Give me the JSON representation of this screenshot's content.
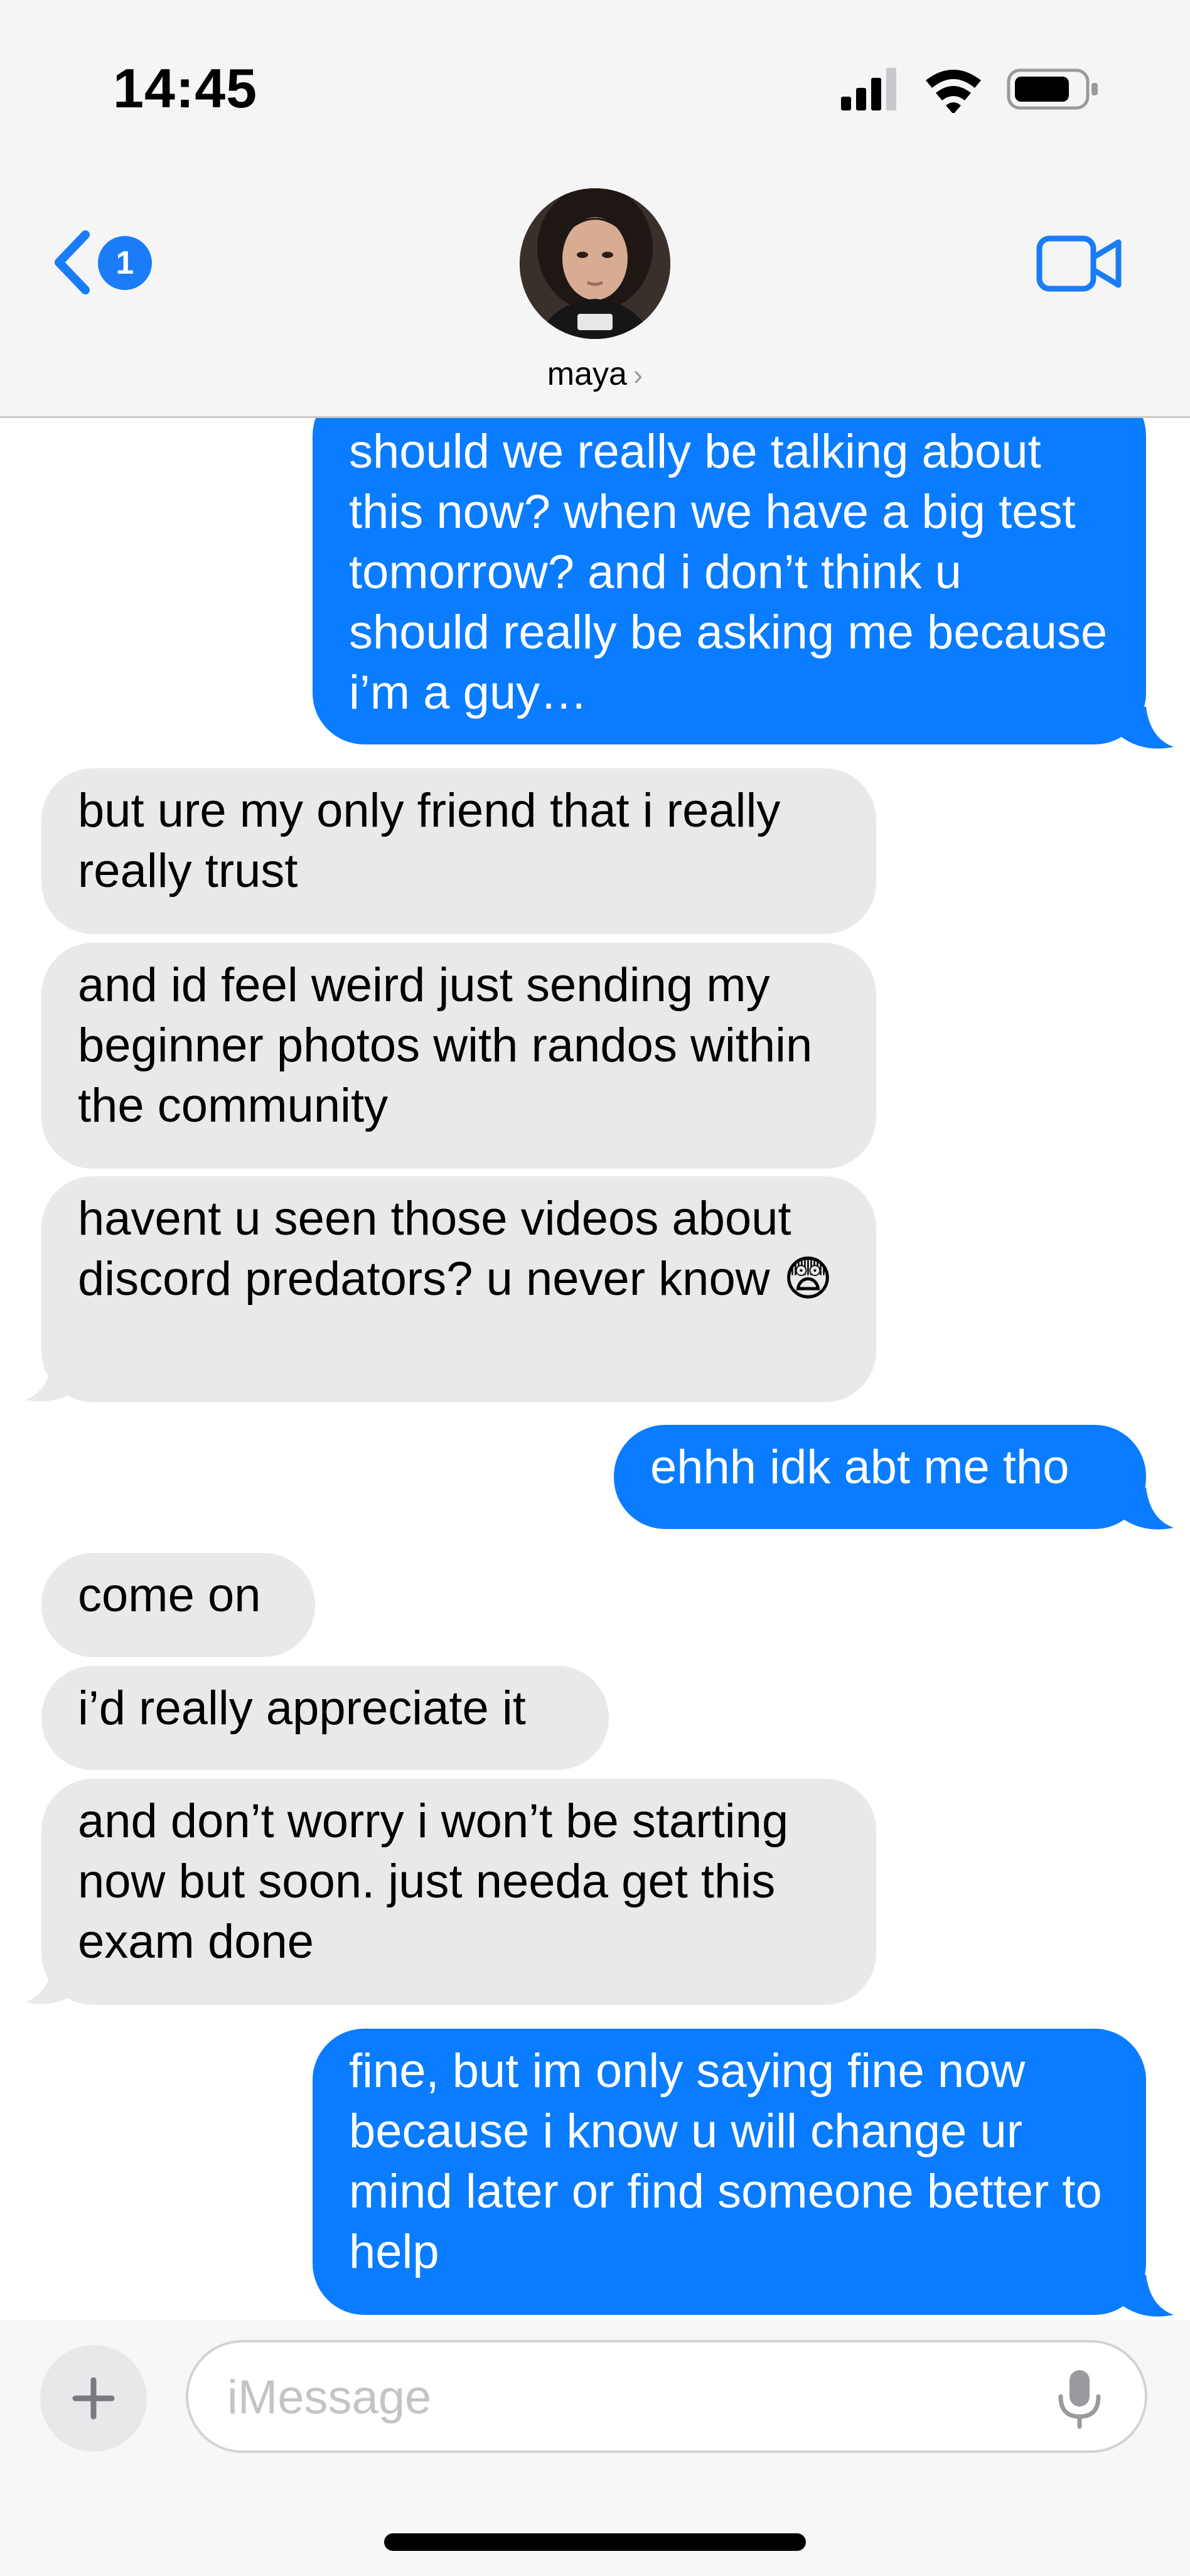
{
  "status_bar": {
    "time": "14:45",
    "signal_icon": "cellular-signal-icon",
    "wifi_icon": "wifi-icon",
    "battery_icon": "battery-icon"
  },
  "nav": {
    "back_icon": "chevron-left-icon",
    "unread_count": "1",
    "contact_name": "maya",
    "contact_chevron": "›",
    "video_icon": "video-camera-icon"
  },
  "messages": [
    {
      "from": "me",
      "text": "should we really be talking about this now? when we have a big test tomorrow? and i don’t think u should really be asking me because i’m a guy…"
    },
    {
      "from": "them",
      "text": "but ure my only friend that i really really trust"
    },
    {
      "from": "them",
      "text": "and id feel weird just sending my beginner photos with randos within the community"
    },
    {
      "from": "them",
      "text": "havent u seen those videos about discord predators? u never know 😨"
    },
    {
      "from": "me",
      "text": "ehhh idk abt me tho"
    },
    {
      "from": "them",
      "text": "come on"
    },
    {
      "from": "them",
      "text": "i’d really appreciate it"
    },
    {
      "from": "them",
      "text": "and don’t worry i won’t be starting now but soon. just needa get this exam done"
    },
    {
      "from": "me",
      "text": "fine, but im only saying fine now because i know u will change ur mind later or find someone better to help"
    }
  ],
  "input": {
    "placeholder": "iMessage",
    "value": "",
    "plus_icon": "plus-icon",
    "mic_icon": "microphone-icon"
  },
  "colors": {
    "sent_bubble": "#0a7cff",
    "received_bubble": "#e9e9eb",
    "accent": "#1a7cf6"
  }
}
